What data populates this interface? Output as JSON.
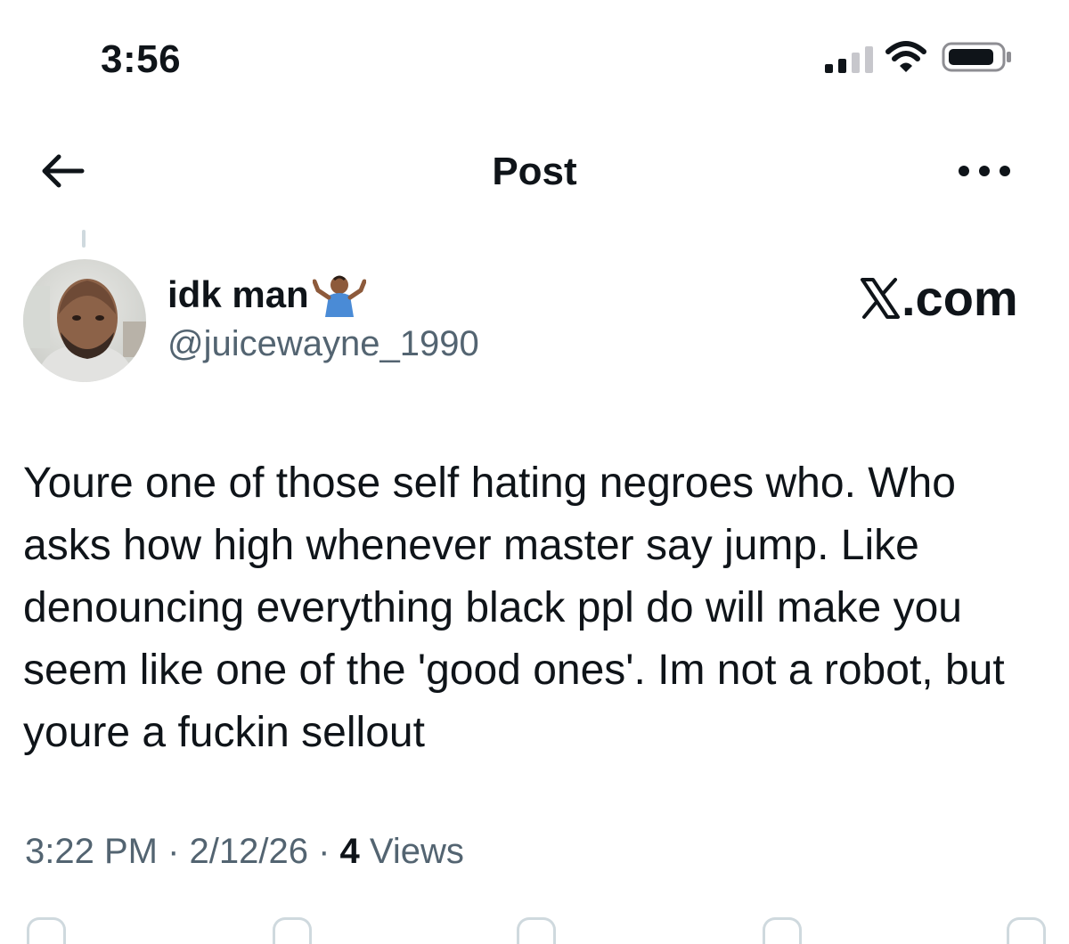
{
  "status_bar": {
    "time": "3:56",
    "icons": [
      "signal-icon",
      "wifi-icon",
      "battery-icon"
    ]
  },
  "header": {
    "title": "Post",
    "back_icon": "back-arrow-icon",
    "more_icon": "more-icon"
  },
  "post": {
    "author": {
      "display_name": "idk man",
      "emoji": "shrug-emoji",
      "handle": "@juicewayne_1990"
    },
    "watermark": ".com",
    "text": "Youre one of those self hating negroes who. Who asks how high whenever master say jump. Like denouncing everything black ppl do will make you seem like one of the 'good ones'. Im not a robot, but youre a fuckin sellout",
    "meta": {
      "time": "3:22 PM",
      "separator": " · ",
      "date": "2/12/26",
      "views_count": "4",
      "views_label": " Views"
    }
  },
  "colors": {
    "text_primary": "#0f1419",
    "text_secondary": "#536471",
    "divider": "#cfd9de"
  }
}
